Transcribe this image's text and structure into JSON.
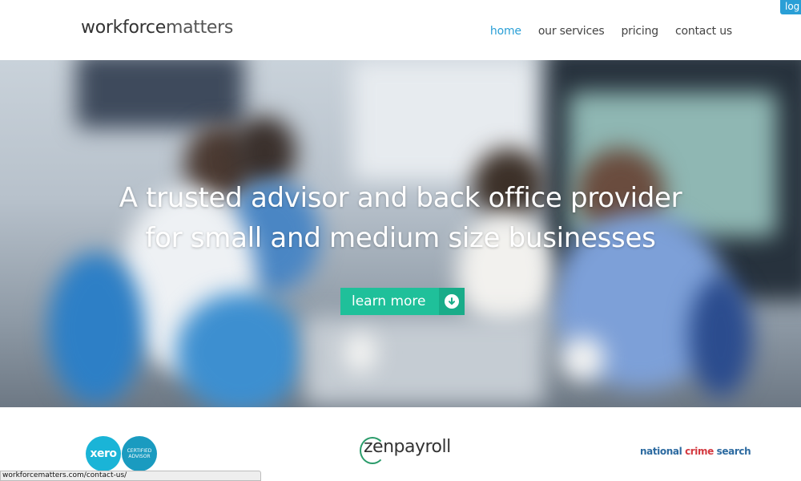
{
  "header": {
    "logo_part1": "workforce",
    "logo_part2": "matters",
    "nav": [
      {
        "label": "home",
        "active": true
      },
      {
        "label": "our services",
        "active": false
      },
      {
        "label": "pricing",
        "active": false
      },
      {
        "label": "contact us",
        "active": false
      }
    ],
    "login_label": "log"
  },
  "hero": {
    "title_line1": "A trusted advisor and back office provider",
    "title_line2": "for small and medium size businesses",
    "cta_label": "learn more",
    "cta_icon": "arrow-down-circle-icon"
  },
  "partners": {
    "xero_label": "xero",
    "xero_cert_line1": "CERTIFIED",
    "xero_cert_line2": "ADVISOR",
    "zenpayroll_label": "zenpayroll",
    "ncs_part1": "national ",
    "ncs_part2": "crime",
    "ncs_part3": " search"
  },
  "statusbar": {
    "url": "workforcematters.com/contact-us/"
  },
  "colors": {
    "accent": "#2a9fd6",
    "cta": "#1fc09a",
    "cta_dark": "#19ac89",
    "xero": "#1ab4d7",
    "ncs_blue": "#2c6aa0",
    "ncs_red": "#d3383f"
  }
}
